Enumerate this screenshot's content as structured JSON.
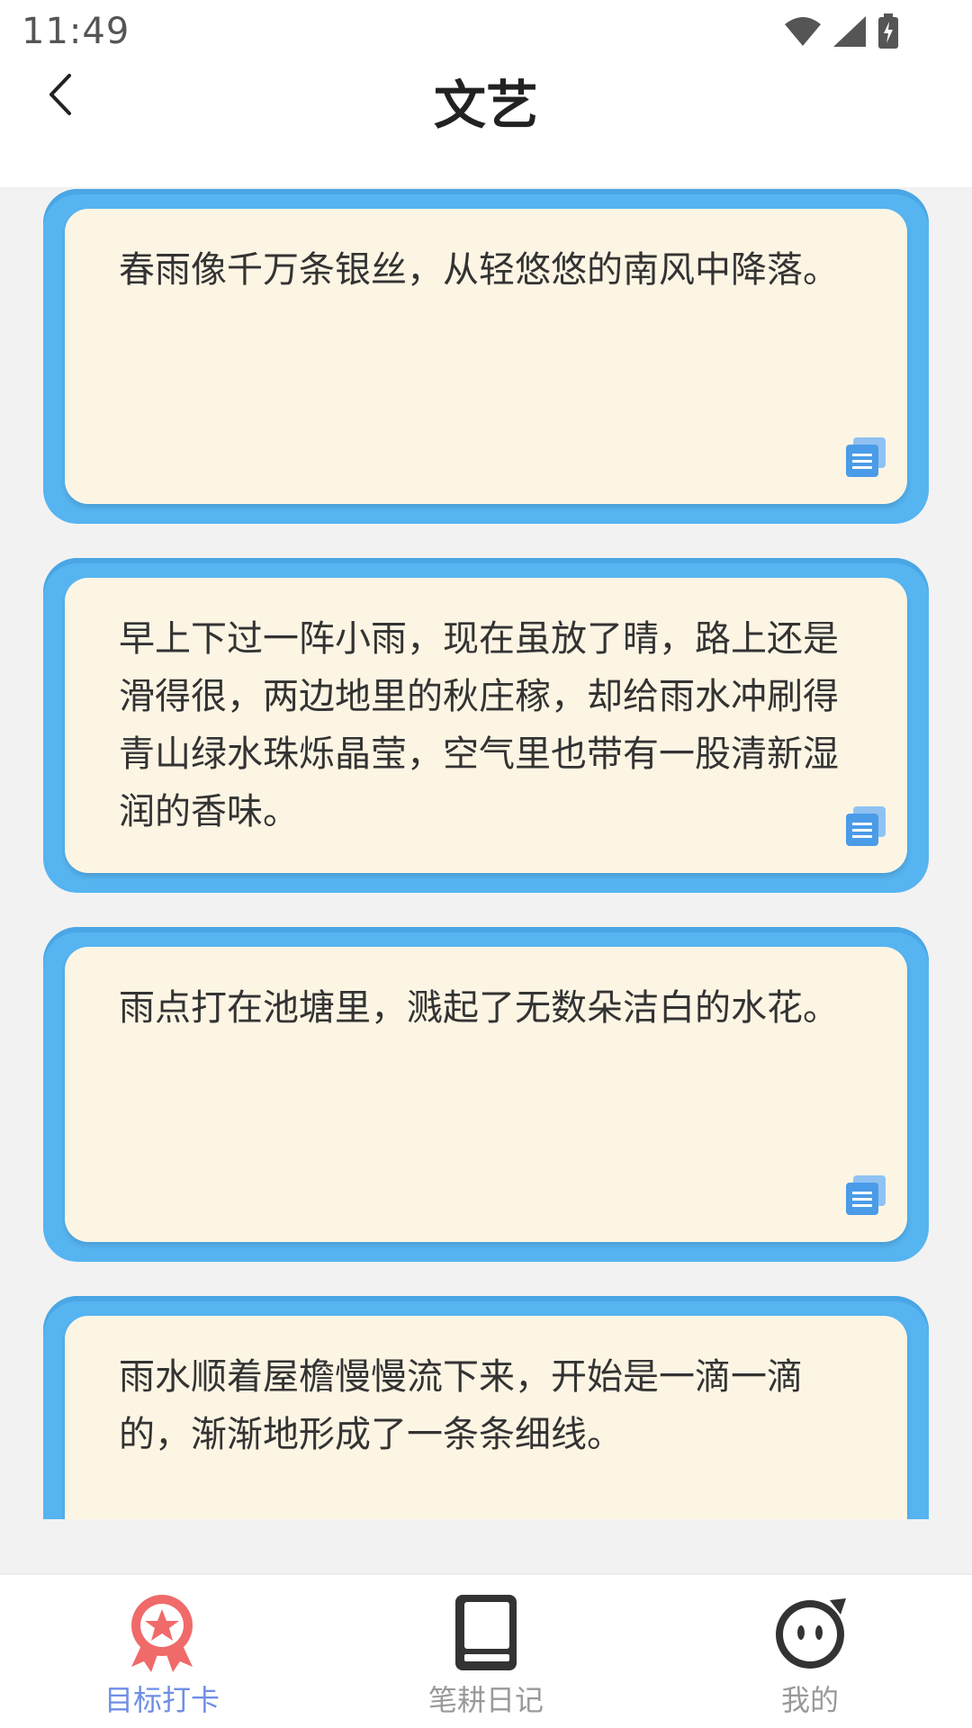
{
  "status": {
    "time": "11:49"
  },
  "header": {
    "title": "文艺"
  },
  "cards": [
    {
      "text": "春雨像千万条银丝，从轻悠悠的南风中降落。"
    },
    {
      "text": "早上下过一阵小雨，现在虽放了晴，路上还是滑得很，两边地里的秋庄稼，却给雨水冲刷得青山绿水珠烁晶莹，空气里也带有一股清新湿润的香味。"
    },
    {
      "text": "雨点打在池塘里，溅起了无数朵洁白的水花。"
    },
    {
      "text": "雨水顺着屋檐慢慢流下来，开始是一滴一滴的，渐渐地形成了一条条细线。"
    }
  ],
  "nav": {
    "items": [
      {
        "label": "目标打卡",
        "icon": "badge-icon",
        "active": true
      },
      {
        "label": "笔耕日记",
        "icon": "book-icon",
        "active": false
      },
      {
        "label": "我的",
        "icon": "face-icon",
        "active": false
      }
    ]
  },
  "colors": {
    "card_border": "#56b4f1",
    "card_bg": "#fdf5e4",
    "active_icon": "#f06a6a",
    "active_label": "#6f8ee6",
    "inactive": "#333333",
    "inactive_label": "#999999",
    "copy_icon": "#4a9be8"
  }
}
